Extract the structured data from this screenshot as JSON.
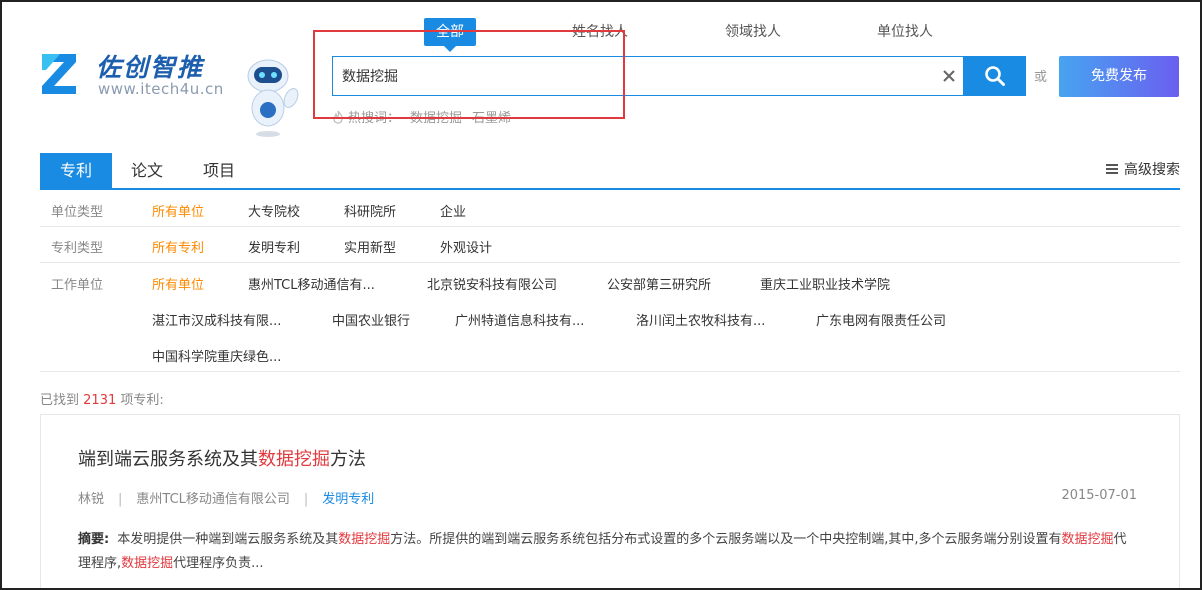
{
  "logo": {
    "name": "佐创智推",
    "url": "www.itech4u.cn"
  },
  "search_tabs": [
    "全部",
    "姓名找人",
    "领域找人",
    "单位找人"
  ],
  "search": {
    "value": "数据挖掘",
    "placeholder": ""
  },
  "or_text": "或",
  "publish_button": "免费发布",
  "hot": {
    "label": "热搜词：",
    "keywords": [
      "数据挖掘",
      "石墨烯"
    ]
  },
  "category_tabs": [
    "专利",
    "论文",
    "项目"
  ],
  "advanced_search": "高级搜索",
  "filters": {
    "unit_type": {
      "label": "单位类型",
      "options": [
        "所有单位",
        "大专院校",
        "科研院所",
        "企业"
      ]
    },
    "patent_type": {
      "label": "专利类型",
      "options": [
        "所有专利",
        "发明专利",
        "实用新型",
        "外观设计"
      ]
    },
    "work_unit": {
      "label": "工作单位",
      "options": [
        "所有单位",
        "惠州TCL移动通信有...",
        "北京锐安科技有限公司",
        "公安部第三研究所",
        "重庆工业职业技术学院",
        "湛江市汉成科技有限...",
        "中国农业银行",
        "广州特道信息科技有...",
        "洛川闰土农牧科技有...",
        "广东电网有限责任公司",
        "中国科学院重庆绿色..."
      ]
    }
  },
  "result_count": {
    "prefix": "已找到",
    "number": "2131",
    "suffix": "项专利:"
  },
  "results": [
    {
      "title_pre": "端到端云服务系统及其",
      "title_hl": "数据挖掘",
      "title_post": "方法",
      "author": "林锐",
      "org": "惠州TCL移动通信有限公司",
      "type": "发明专利",
      "date": "2015-07-01",
      "abstract_label": "摘要:",
      "abs_1": "本发明提供一种端到端云服务系统及其",
      "abs_hl1": "数据挖掘",
      "abs_2": "方法。所提供的端到端云服务系统包括分布式设置的多个云服务端以及一个中央控制端,其中,多个云服务端分别设置有",
      "abs_hl2": "数据挖掘",
      "abs_3": "代理程序,",
      "abs_hl3": "数据挖掘",
      "abs_4": "代理程序负责..."
    }
  ],
  "colors": {
    "accent": "#1a8be2",
    "highlight": "#e0393e",
    "selected": "#ff8a00",
    "annotation_box": "#e0393e"
  }
}
